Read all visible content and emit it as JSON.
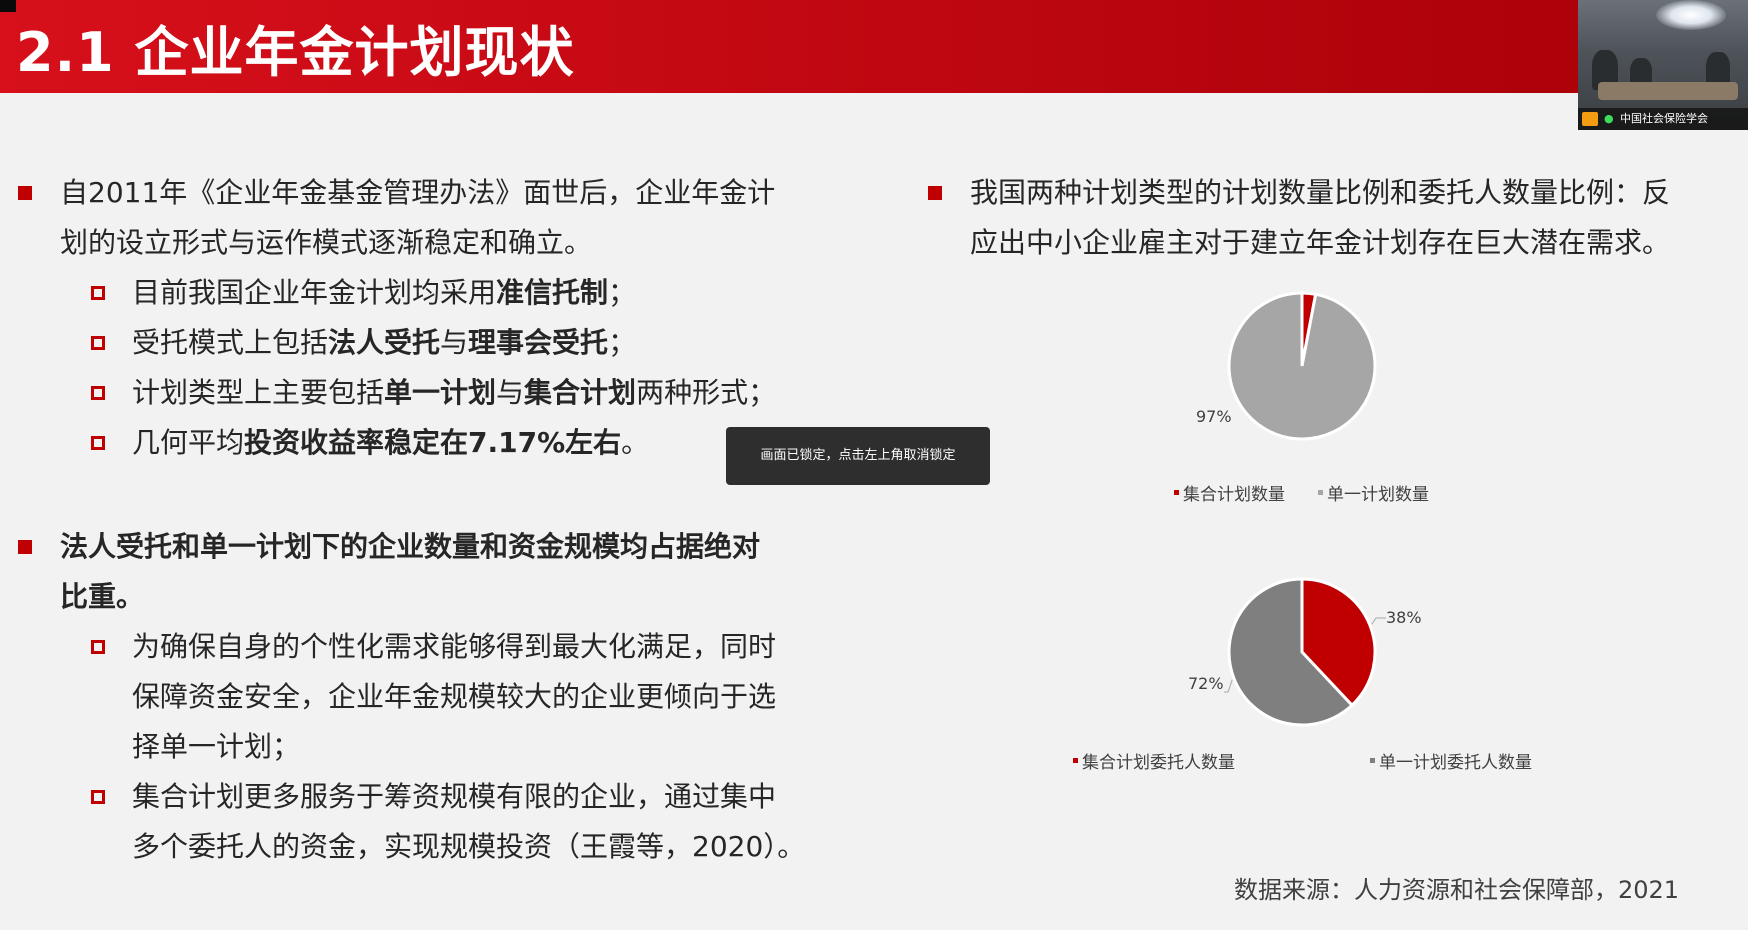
{
  "header": {
    "title": "2.1 企业年金计划现状"
  },
  "video_tile": {
    "name": "中国社会保险学会"
  },
  "left": {
    "bullet1": {
      "line1": "自2011年《企业年金基金管理办法》面世后，企业年金计",
      "line2": "划的设立形式与运作模式逐渐稳定和确立。",
      "subs": [
        {
          "pre": "目前我国企业年金计划均采用",
          "b1": "准信托制",
          "mid": "",
          "b2": "",
          "post": "；"
        },
        {
          "pre": "受托模式上包括",
          "b1": "法人受托",
          "mid": "与",
          "b2": "理事会受托",
          "post": "；"
        },
        {
          "pre": "计划类型上主要包括",
          "b1": "单一计划",
          "mid": "与",
          "b2": "集合计划",
          "post": "两种形式；"
        },
        {
          "pre": "几何平均",
          "b1": "投资收益率稳定在7.17%左右",
          "mid": "",
          "b2": "",
          "post": "。"
        }
      ]
    },
    "bullet2": {
      "line1": "法人受托和单一计划下的企业数量和资金规模均占据绝对",
      "line2": "比重。",
      "sub1": [
        "为确保自身的个性化需求能够得到最大化满足，同时",
        "保障资金安全，企业年金规模较大的企业更倾向于选",
        "择单一计划；"
      ],
      "sub2": [
        "集合计划更多服务于筹资规模有限的企业，通过集中",
        "多个委托人的资金，实现规模投资（王霞等，2020）。"
      ]
    }
  },
  "right": {
    "bullet": {
      "line1": "我国两种计划类型的计划数量比例和委托人数量比例：反",
      "line2": "应出中小企业雇主对于建立年金计划存在巨大潜在需求。"
    }
  },
  "chart_data": [
    {
      "type": "pie",
      "categories": [
        "集合计划数量",
        "单一计划数量"
      ],
      "values": [
        3,
        97
      ],
      "labels": [
        "3%",
        "97%"
      ],
      "colors": [
        "#c00000",
        "#a6a6a6"
      ],
      "legend": "bottom"
    },
    {
      "type": "pie",
      "categories": [
        "集合计划委托人数量",
        "单一计划委托人数量"
      ],
      "values": [
        38,
        62
      ],
      "labels": [
        "38%",
        "72%"
      ],
      "colors": [
        "#c00000",
        "#7f7f7f"
      ],
      "legend": "bottom"
    }
  ],
  "toast": {
    "text": "画面已锁定，点击左上角取消锁定"
  },
  "source": {
    "text": "数据来源：人力资源和社会保障部，2021"
  }
}
